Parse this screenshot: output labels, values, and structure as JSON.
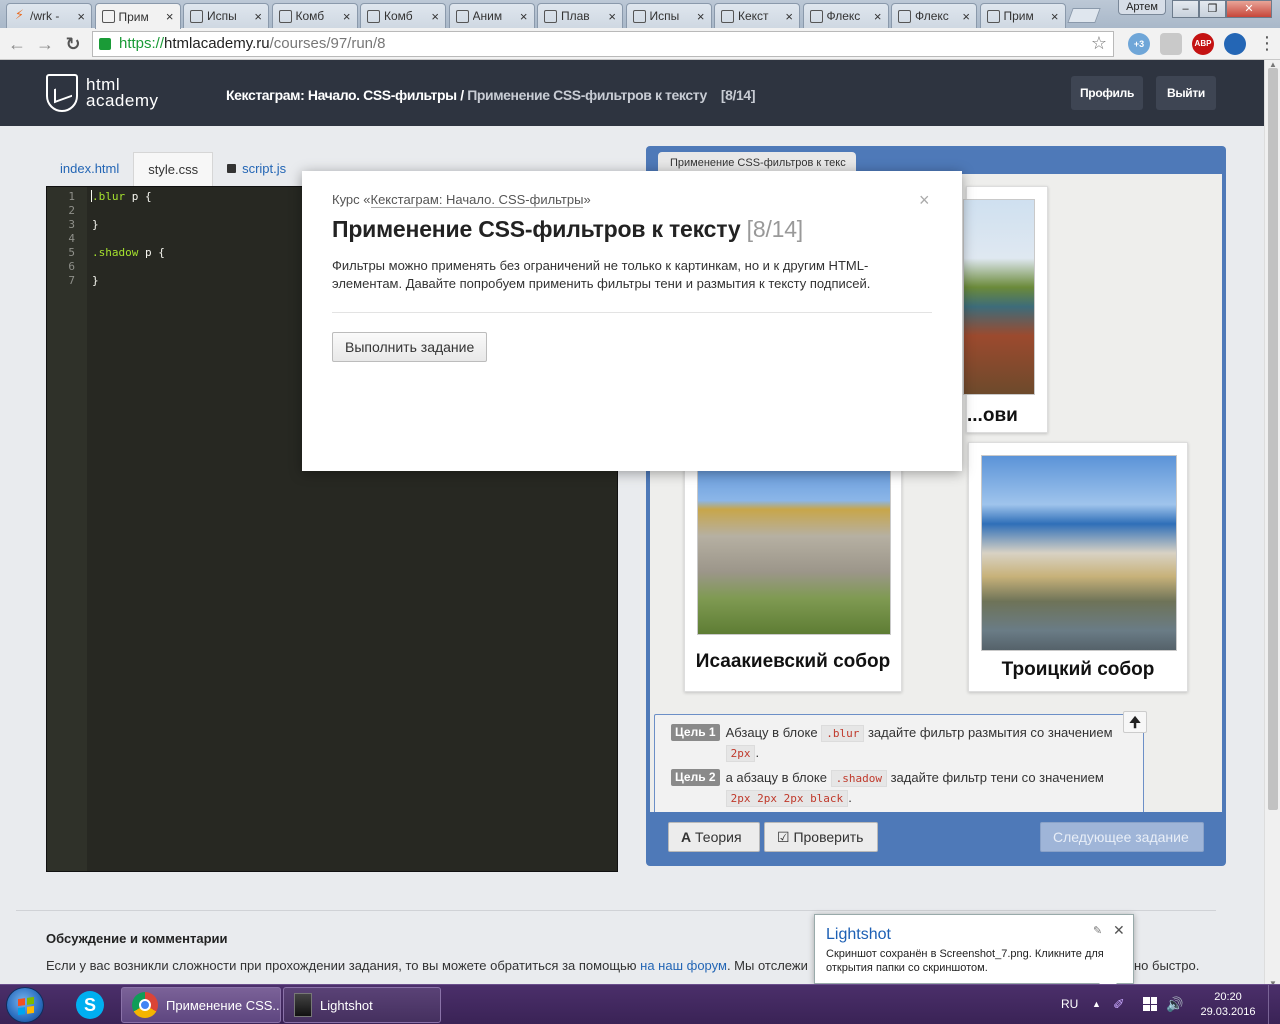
{
  "browser": {
    "tabs": [
      {
        "label": "/wrk -",
        "icon": "lightning-icon"
      },
      {
        "label": "Прим",
        "icon": "htmlacademy-icon",
        "active": true
      },
      {
        "label": "Испы",
        "icon": "htmlacademy-icon"
      },
      {
        "label": "Комб",
        "icon": "htmlacademy-icon"
      },
      {
        "label": "Комб",
        "icon": "htmlacademy-icon"
      },
      {
        "label": "Аним",
        "icon": "htmlacademy-icon"
      },
      {
        "label": "Плав",
        "icon": "htmlacademy-icon"
      },
      {
        "label": "Испы",
        "icon": "htmlacademy-icon"
      },
      {
        "label": "Кекст",
        "icon": "htmlacademy-icon"
      },
      {
        "label": "Флекс",
        "icon": "htmlacademy-icon"
      },
      {
        "label": "Флекс",
        "icon": "htmlacademy-icon"
      },
      {
        "label": "Прим",
        "icon": "htmlacademy-icon"
      }
    ],
    "user": "Артем",
    "url": {
      "scheme": "https://",
      "host": "htmlacademy.ru",
      "path": "/courses/97/run/8"
    },
    "ext_badge": "+3",
    "abp_label": "ABP"
  },
  "header": {
    "logo_line1": "html",
    "logo_line2": "academy",
    "breadcrumb_course": "Кекстаграм: Начало. CSS-фильтры",
    "breadcrumb_sep": " / ",
    "breadcrumb_current": "Применение CSS-фильтров к тексту",
    "breadcrumb_step": "[8/14]",
    "profile_label": "Профиль",
    "logout_label": "Выйти"
  },
  "editor": {
    "tabs": [
      "index.html",
      "style.css",
      "script.js"
    ],
    "active_tab": "style.css",
    "locked_tab": "script.js",
    "lines": [
      {
        "n": "1",
        "sel": ".blur",
        "rest": " p {"
      },
      {
        "n": "2",
        "sel": "",
        "rest": ""
      },
      {
        "n": "3",
        "sel": "",
        "rest": "}"
      },
      {
        "n": "4",
        "sel": "",
        "rest": ""
      },
      {
        "n": "5",
        "sel": ".shadow",
        "rest": " p {"
      },
      {
        "n": "6",
        "sel": "",
        "rest": ""
      },
      {
        "n": "7",
        "sel": "",
        "rest": "}"
      }
    ]
  },
  "preview": {
    "tab_label": "Применение CSS-фильтров к текс",
    "cards": [
      {
        "caption": "...ови"
      },
      {
        "caption": "Исаакиевский собор"
      },
      {
        "caption": "Троицкий собор"
      }
    ],
    "goals": [
      {
        "label": "Цель 1",
        "text1": "Абзацу в блоке ",
        "code1": ".blur",
        "text2": " задайте фильтр размытия со значением ",
        "code2": "2px",
        "text3": "."
      },
      {
        "label": "Цель 2",
        "text1": "а абзацу в блоке ",
        "code1": ".shadow",
        "text2": " задайте фильтр тени со значением ",
        "code2": "2px 2px 2px black",
        "text3": "."
      }
    ],
    "theory_label": "Теория",
    "check_label": "Проверить",
    "next_label": "Следующее задание"
  },
  "discussion": {
    "title": "Обсуждение и комментарии",
    "text_before": "Если у вас возникли сложности при прохождении задания, то вы можете обратиться за помощью ",
    "link": "на наш форум",
    "text_after": ". Мы отслежи",
    "text_tail": "но быстро."
  },
  "modal": {
    "course_prefix": "Курс «",
    "course_link": "Кекстаграм: Начало. CSS-фильтры",
    "course_suffix": "»",
    "title": "Применение CSS-фильтров к тексту",
    "step": "[8/14]",
    "text": "Фильтры можно применять без ограничений не только к картинкам, но и к другим HTML-элементам. Давайте попробуем применить фильтры тени и размытия к тексту подписей.",
    "button": "Выполнить задание",
    "close": "×"
  },
  "notification": {
    "title": "Lightshot",
    "text": "Скриншот сохранён в Screenshot_7.png. Кликните для открытия папки со скриншотом."
  },
  "taskbar": {
    "tasks": [
      "Применение CSS...",
      "Lightshot"
    ],
    "lang": "RU",
    "time": "20:20",
    "date": "29.03.2016"
  }
}
